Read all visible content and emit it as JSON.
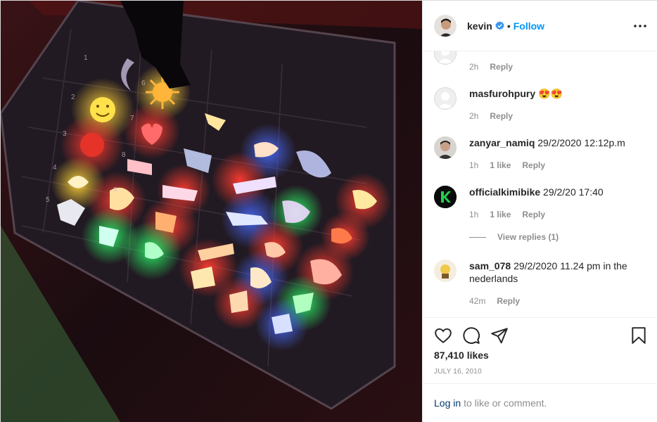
{
  "header": {
    "username": "kevin",
    "dot": "•",
    "follow_label": "Follow"
  },
  "comments": [
    {
      "username": "",
      "text": "",
      "time": "2h",
      "likes": "",
      "reply_label": "Reply"
    },
    {
      "username": "masfurohpury",
      "text": "😍😍",
      "time": "2h",
      "likes": "",
      "reply_label": "Reply"
    },
    {
      "username": "zanyar_namiq",
      "text": "29/2/2020 12:12p.m",
      "time": "1h",
      "likes": "1 like",
      "reply_label": "Reply"
    },
    {
      "username": "officialkimibike",
      "text": "29/2/20 17:40",
      "time": "1h",
      "likes": "1 like",
      "reply_label": "Reply"
    },
    {
      "username": "sam_078",
      "text": "29/2/2020 11.24 pm in the nederlands",
      "time": "42m",
      "likes": "",
      "reply_label": "Reply"
    }
  ],
  "view_replies_label": "View replies (1)",
  "actions": {
    "like_icon": "heart-icon",
    "comment_icon": "comment-icon",
    "share_icon": "paper-plane-icon",
    "save_icon": "bookmark-icon"
  },
  "likes_label": "87,410 likes",
  "date_label": "JULY 16, 2010",
  "login": {
    "link_label": "Log in",
    "rest_text": "to like or comment."
  },
  "colors": {
    "accent": "#0095f6",
    "text": "#262626",
    "muted": "#8e8e8e",
    "link": "#00376b",
    "border": "#efefef"
  }
}
